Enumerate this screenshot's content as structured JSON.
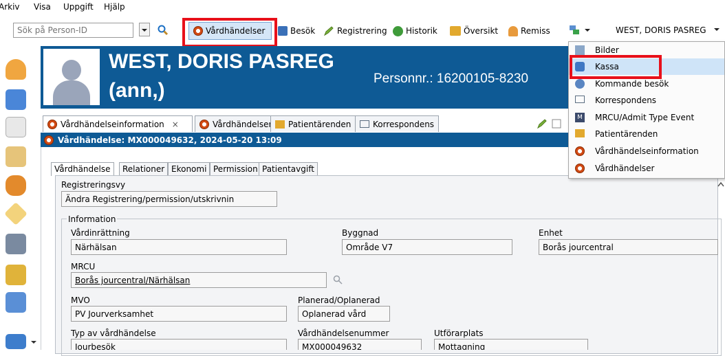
{
  "menubar": {
    "items": [
      "Arkiv",
      "Visa",
      "Uppgift",
      "Hjälp"
    ]
  },
  "toolbar": {
    "search_placeholder": "Sök på Person-ID",
    "buttons": [
      "Vårdhändelser",
      "Besök",
      "Registrering",
      "Historik",
      "Översikt",
      "Remiss"
    ],
    "user_label": "WEST, DORIS PASREG"
  },
  "patient": {
    "name_line1": "WEST, DORIS PASREG",
    "name_line2": "(ann,)",
    "personnr_label": "Personnr.:",
    "personnr_value": "16200105-8230"
  },
  "tabs": [
    "Vårdhändelseinformation",
    "Vårdhändelser",
    "Patientärenden",
    "Korrespondens"
  ],
  "close_glyph": "×",
  "section_title": "Vårdhändelse: MX000049632, 2024-05-20 13:09",
  "subtabs": [
    "Vårdhändelse",
    "Relationer",
    "Ekonomi",
    "Permission",
    "Patientavgift"
  ],
  "form": {
    "registreringsvy_label": "Registreringsvy",
    "registreringsvy_value": "Ändra Registrering/permission/utskrivnin",
    "information_label": "Information",
    "vardinrattning_label": "Vårdinrättning",
    "vardinrattning_value": "Närhälsan",
    "byggnad_label": "Byggnad",
    "byggnad_value": "Område V7",
    "enhet_label": "Enhet",
    "enhet_value": "Borås jourcentral",
    "mrcu_label": "MRCU",
    "mrcu_value": "Borås jourcentral/Närhälsan",
    "mvo_label": "MVO",
    "mvo_value": "PV Jourverksamhet",
    "planerad_label": "Planerad/Oplanerad",
    "planerad_value": "Oplanerad vård",
    "typ_label": "Typ av vårdhändelse",
    "typ_value": "Jourbesök",
    "nummer_label": "Vårdhändelsenummer",
    "nummer_value": "MX000049632",
    "utforarplats_label": "Utförarplats",
    "utforarplats_value": "Mottagning"
  },
  "dropdown_menu": {
    "items": [
      "Bilder",
      "Kassa",
      "Kommande besök",
      "Korrespondens",
      "MRCU/Admit Type Event",
      "Patientärenden",
      "Vårdhändelseinformation",
      "Vårdhändelser"
    ],
    "highlighted": "Kassa",
    "mrcu_badge": "M"
  },
  "colors": {
    "header_blue": "#0e5a95",
    "highlight_red": "#e8101a",
    "menu_highlight": "#cfe4f8"
  }
}
